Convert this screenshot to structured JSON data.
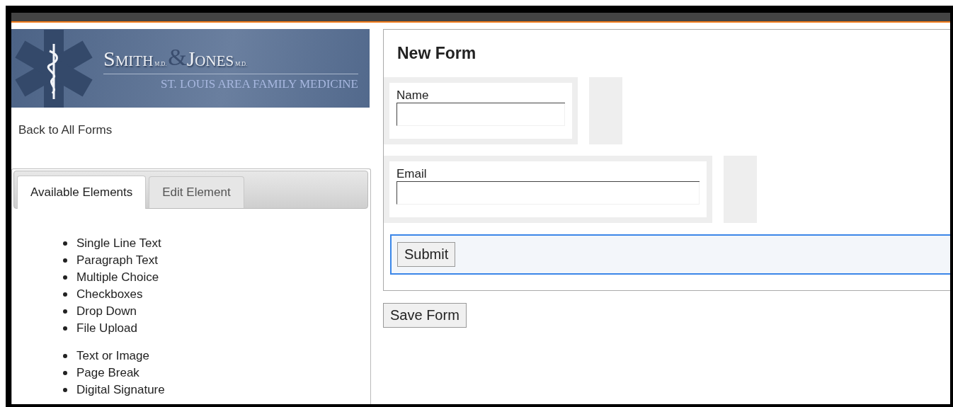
{
  "logo": {
    "name_first": "Smith",
    "degree_first": "M.D.",
    "ampersand": "&",
    "name_second": "Jones",
    "degree_second": "M.D.",
    "tagline": "ST. LOUIS AREA FAMILY MEDICINE"
  },
  "back_link": "Back to All Forms",
  "tabs": [
    {
      "label": "Available Elements",
      "selected": true
    },
    {
      "label": "Edit Element",
      "selected": false
    }
  ],
  "element_groups": [
    [
      "Single Line Text",
      "Paragraph Text",
      "Multiple Choice",
      "Checkboxes",
      "Drop Down",
      "File Upload"
    ],
    [
      "Text or Image",
      "Page Break",
      "Digital Signature"
    ]
  ],
  "form": {
    "title": "New Form",
    "fields": [
      {
        "label": "Name",
        "kind": "short"
      },
      {
        "label": "Email",
        "kind": "long"
      }
    ],
    "submit": "Submit"
  },
  "save_button": "Save Form"
}
